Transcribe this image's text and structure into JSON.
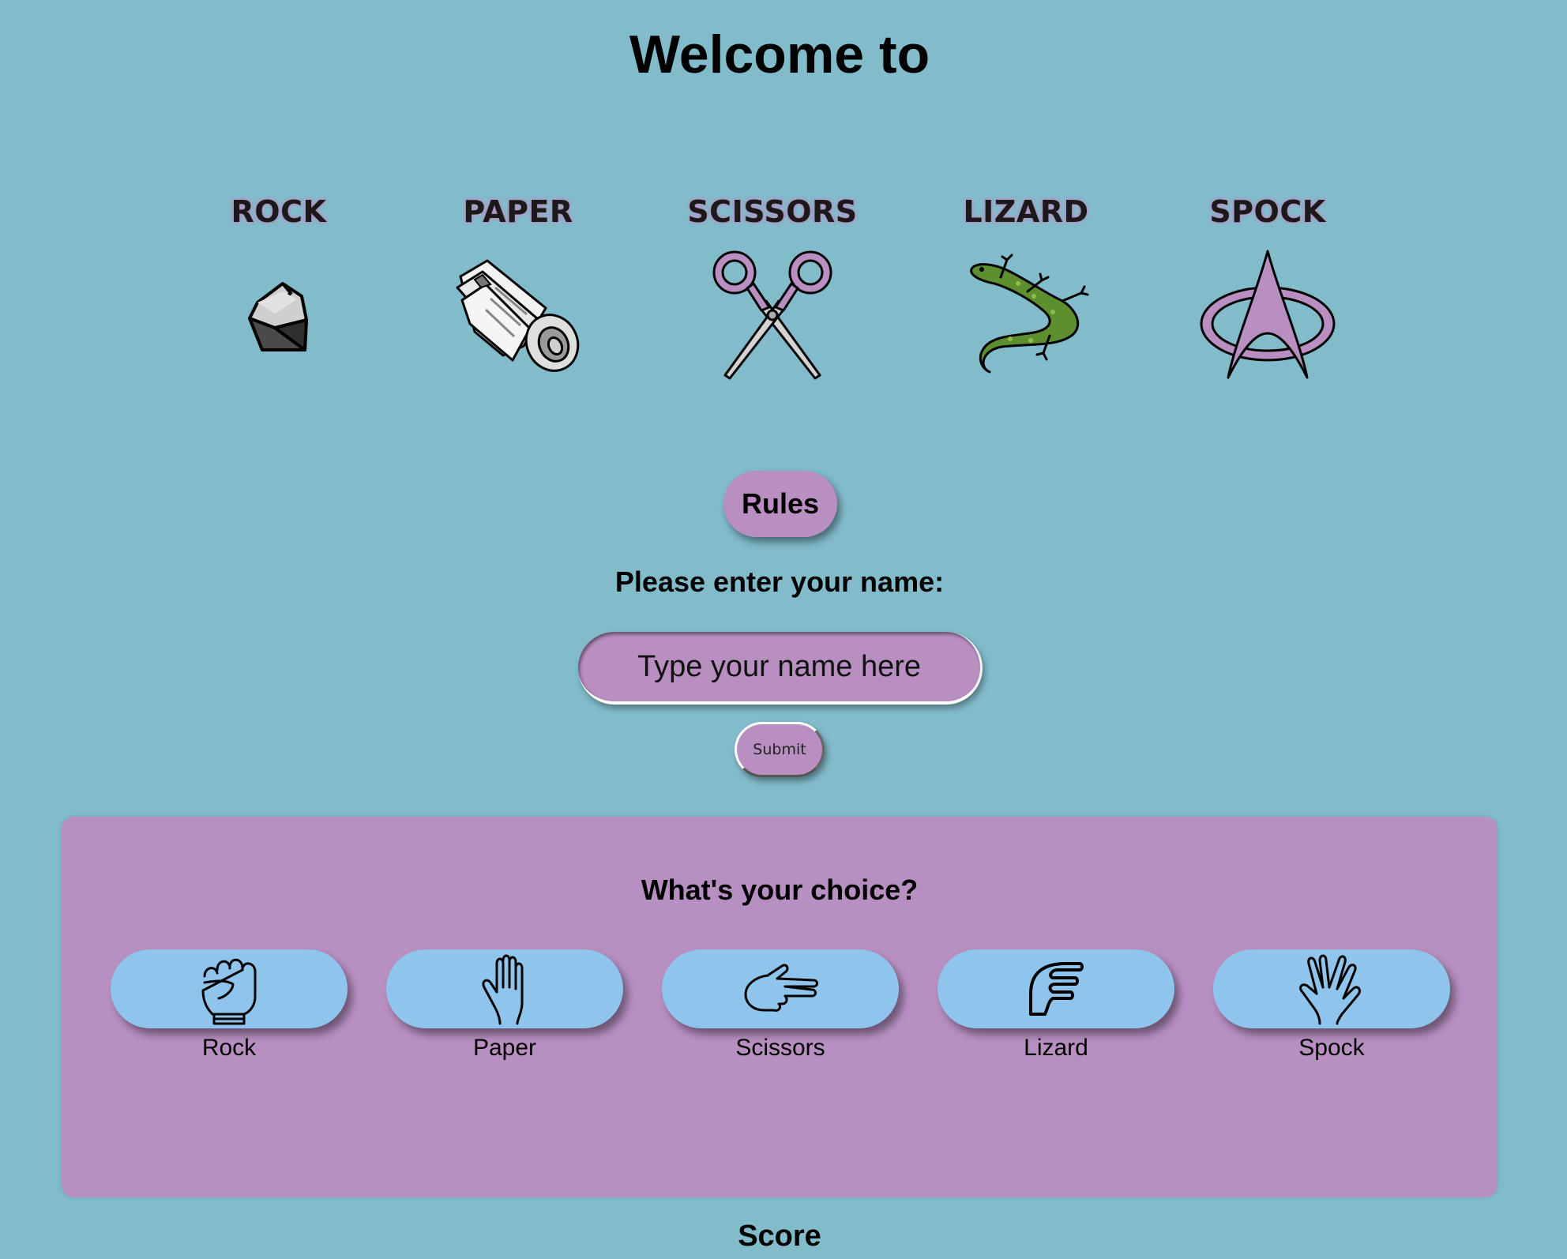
{
  "page": {
    "title": "Welcome to",
    "background_color": "#82bccb",
    "accent_color": "#b98fc2",
    "choice_button_color": "#8fc4ed"
  },
  "logo_items": [
    {
      "label": "ROCK",
      "icon": "rock-icon"
    },
    {
      "label": "PAPER",
      "icon": "newspaper-icon"
    },
    {
      "label": "SCISSORS",
      "icon": "scissors-icon"
    },
    {
      "label": "LIZARD",
      "icon": "lizard-icon"
    },
    {
      "label": "SPOCK",
      "icon": "starfleet-icon"
    }
  ],
  "rules_button": {
    "label": "Rules"
  },
  "name_form": {
    "prompt": "Please enter your name:",
    "placeholder": "Type your name here",
    "submit_label": "Submit"
  },
  "choice_panel": {
    "title": "What's your choice?",
    "choices": [
      {
        "label": "Rock",
        "icon": "fist-hand-icon"
      },
      {
        "label": "Paper",
        "icon": "open-hand-icon"
      },
      {
        "label": "Scissors",
        "icon": "scissors-hand-icon"
      },
      {
        "label": "Lizard",
        "icon": "lizard-hand-icon"
      },
      {
        "label": "Spock",
        "icon": "vulcan-hand-icon"
      }
    ]
  },
  "score": {
    "heading": "Score"
  }
}
